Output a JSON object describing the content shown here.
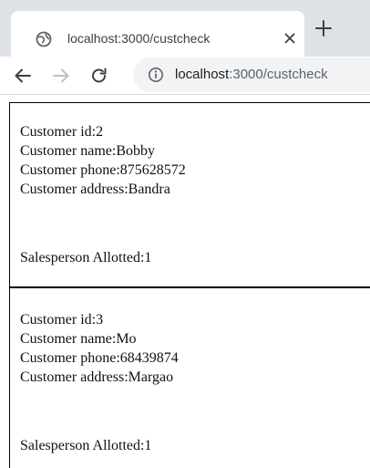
{
  "browser": {
    "tab": {
      "title": "localhost:3000/custcheck",
      "favicon": "globe-icon",
      "close": "close-icon"
    },
    "new_tab": "plus-icon",
    "nav": {
      "back": "back-arrow-icon",
      "forward": "forward-arrow-icon",
      "reload": "reload-icon"
    },
    "address": {
      "host": "localhost",
      "path": ":3000/custcheck",
      "info": "info-icon"
    }
  },
  "customers": [
    {
      "id_line": "Customer id:2",
      "name_line": "Customer name:Bobby",
      "phone_line": "Customer phone:875628572",
      "address_line": "Customer address:Bandra",
      "salesperson_line": "Salesperson Allotted:1"
    },
    {
      "id_line": "Customer id:3",
      "name_line": "Customer name:Mo",
      "phone_line": "Customer phone:68439874",
      "address_line": "Customer address:Margao",
      "salesperson_line": "Salesperson Allotted:1"
    }
  ],
  "colors": {
    "tabstrip": "#dee1e6",
    "omnibox": "#f1f3f4",
    "text": "#111111",
    "icon": "#5f6368"
  }
}
